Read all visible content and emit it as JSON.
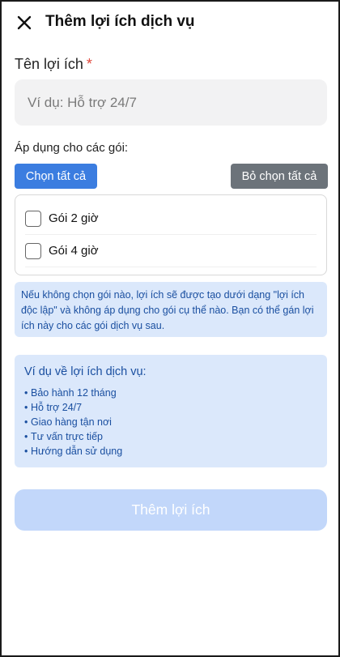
{
  "header": {
    "close_icon": "close-icon",
    "title": "Thêm lợi ích dịch vụ"
  },
  "benefit_name": {
    "label": "Tên lợi ích",
    "required_mark": "*",
    "placeholder": "Ví dụ: Hỗ trợ 24/7",
    "value": ""
  },
  "packages": {
    "label": "Áp dụng cho các gói:",
    "select_all_label": "Chọn tất cả",
    "deselect_all_label": "Bỏ chọn tất cả",
    "items": [
      {
        "label": "Gói 2 giờ",
        "checked": false
      },
      {
        "label": "Gói 4 giờ",
        "checked": false
      }
    ]
  },
  "info": {
    "text": "Nếu không chọn gói nào, lợi ích sẽ được tạo dưới dạng \"lợi ích độc lập\" và không áp dụng cho gói cụ thể nào. Bạn có thể gán lợi ích này cho các gói dịch vụ sau."
  },
  "examples": {
    "title": "Ví dụ về lợi ích dịch vụ:",
    "items": [
      "Bảo hành 12 tháng",
      "Hỗ trợ 24/7",
      "Giao hàng tận nơi",
      "Tư vấn trực tiếp",
      "Hướng dẫn sử dụng"
    ]
  },
  "submit": {
    "label": "Thêm lợi ích"
  },
  "colors": {
    "primary": "#3b7de0",
    "secondary": "#6c737a",
    "info_bg": "#dbe8fb",
    "info_text": "#1a4fa0",
    "submit_disabled_bg": "#c2d7fa",
    "required": "#e0483c"
  }
}
